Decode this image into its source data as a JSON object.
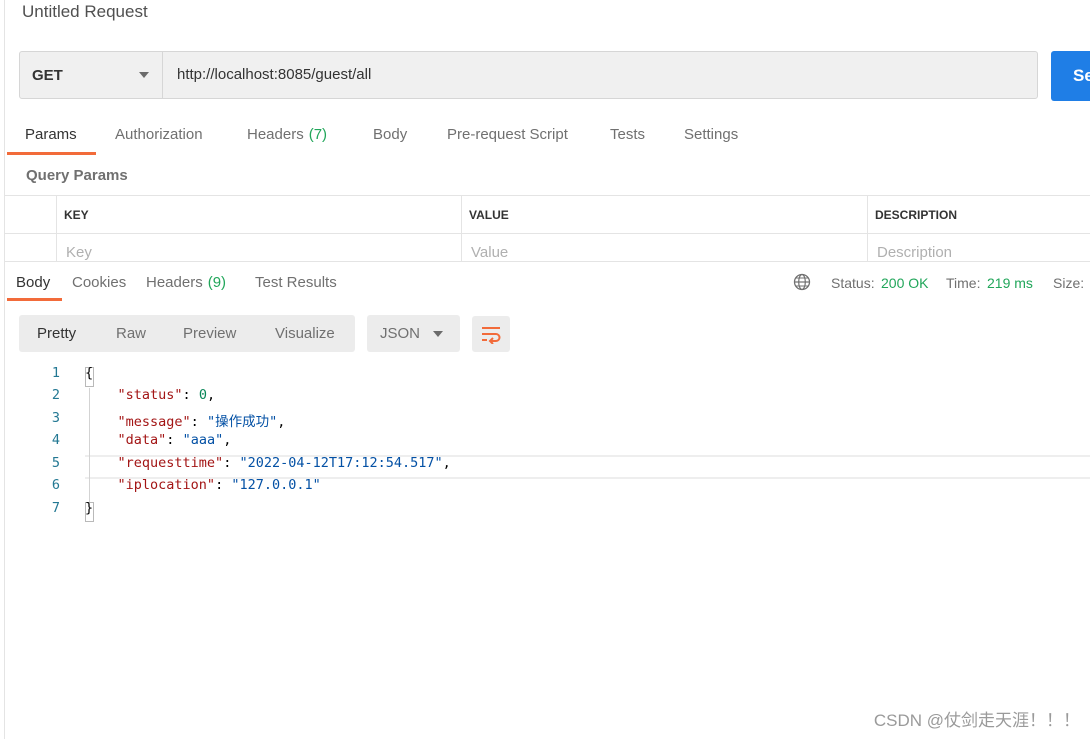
{
  "request": {
    "title": "Untitled Request",
    "method": "GET",
    "url": "http://localhost:8085/guest/all",
    "send_label": "Se"
  },
  "request_tabs": [
    {
      "label": "Params",
      "count": "",
      "active": true
    },
    {
      "label": "Authorization",
      "count": ""
    },
    {
      "label": "Headers",
      "count": "(7)"
    },
    {
      "label": "Body",
      "count": ""
    },
    {
      "label": "Pre-request Script",
      "count": ""
    },
    {
      "label": "Tests",
      "count": ""
    },
    {
      "label": "Settings",
      "count": ""
    }
  ],
  "query_params": {
    "title": "Query Params",
    "columns": [
      "KEY",
      "VALUE",
      "DESCRIPTION"
    ],
    "placeholders": [
      "Key",
      "Value",
      "Description"
    ]
  },
  "response_tabs": [
    {
      "label": "Body",
      "count": "",
      "active": true
    },
    {
      "label": "Cookies",
      "count": ""
    },
    {
      "label": "Headers",
      "count": "(9)"
    },
    {
      "label": "Test Results",
      "count": ""
    }
  ],
  "response_meta": {
    "status_label": "Status:",
    "status_value": "200 OK",
    "time_label": "Time:",
    "time_value": "219 ms",
    "size_label": "Size:"
  },
  "view_modes": [
    "Pretty",
    "Raw",
    "Preview",
    "Visualize"
  ],
  "format": "JSON",
  "code_lines": [
    {
      "n": "1",
      "text": "{"
    },
    {
      "n": "2",
      "key": "\"status\"",
      "value": "0",
      "type": "number",
      "comma": ","
    },
    {
      "n": "3",
      "key": "\"message\"",
      "value": "\"操作成功\"",
      "type": "string",
      "comma": ","
    },
    {
      "n": "4",
      "key": "\"data\"",
      "value": "\"aaa\"",
      "type": "string",
      "comma": ","
    },
    {
      "n": "5",
      "key": "\"requesttime\"",
      "value": "\"2022-04-12T17:12:54.517\"",
      "type": "string",
      "comma": ","
    },
    {
      "n": "6",
      "key": "\"iplocation\"",
      "value": "\"127.0.0.1\"",
      "type": "string",
      "comma": ""
    },
    {
      "n": "7",
      "text": "}"
    }
  ],
  "watermark": "CSDN @仗剑走天涯！！！",
  "colors": {
    "accent": "#f26b3a",
    "send": "#1f7ee6",
    "count": "#21a65a"
  }
}
